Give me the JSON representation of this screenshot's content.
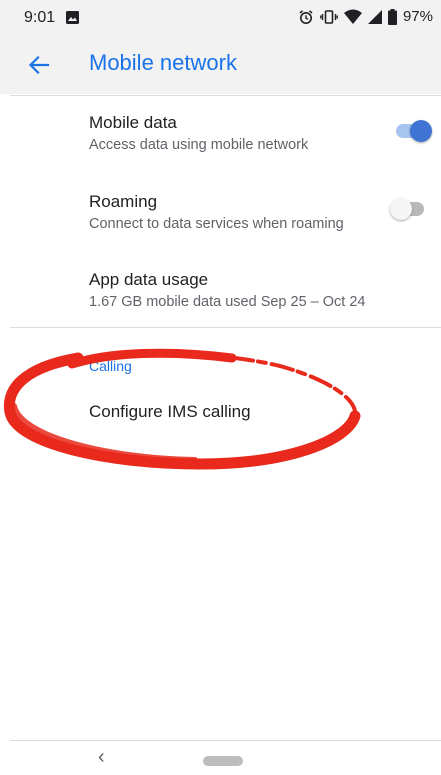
{
  "status_bar": {
    "time": "9:01",
    "battery_percent": "97%",
    "icons": [
      "image-icon",
      "alarm-icon",
      "vibrate-icon",
      "wifi-icon",
      "cell-signal-icon",
      "battery-icon"
    ]
  },
  "app_bar": {
    "back_icon": "arrow-left-icon",
    "title": "Mobile network"
  },
  "preferences": [
    {
      "title": "Mobile data",
      "summary": "Access data using mobile network",
      "toggle": true
    },
    {
      "title": "Roaming",
      "summary": "Connect to data services when roaming",
      "toggle": false
    },
    {
      "title": "App data usage",
      "summary": "1.67 GB mobile data used Sep 25 – Oct 24"
    }
  ],
  "calling_section": {
    "category": "Calling",
    "item": "Configure IMS calling"
  },
  "annotation": {
    "color": "#e8291c"
  },
  "colors": {
    "accent": "#1a73e8",
    "toggle_on_thumb": "#3f73d4",
    "toggle_on_track": "#a6c4f0",
    "app_bar_bg": "#f2f2f2"
  },
  "nav_bar": {
    "icons": [
      "nav-back-icon",
      "home-pill-icon"
    ]
  }
}
